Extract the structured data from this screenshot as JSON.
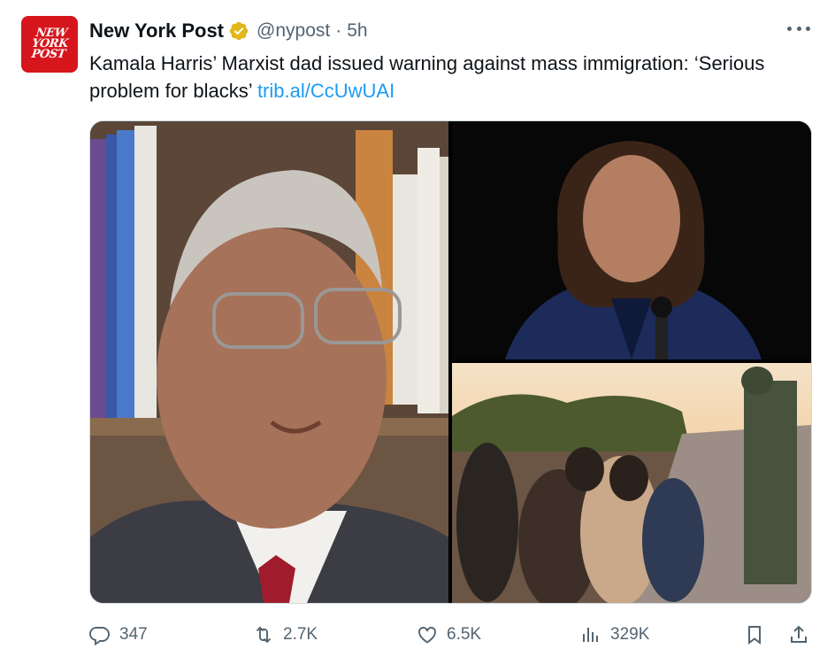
{
  "tweet": {
    "author": {
      "avatar_lines": [
        "NEW",
        "YORK",
        "POST"
      ],
      "name": "New York Post",
      "verified_badge": "gold-verified-badge-icon",
      "handle": "@nypost",
      "separator": "·",
      "timestamp": "5h"
    },
    "menu_icon": "more-horizontal-icon",
    "text": {
      "body": "Kamala Harris’ Marxist dad issued warning against mass immigration: ‘Serious problem for blacks’",
      "link": "trib.al/CcUwUAI"
    },
    "media": [
      {
        "icon": "photo-portrait-elderly-man"
      },
      {
        "icon": "photo-kamala-harris-podium"
      },
      {
        "icon": "photo-migrants-border"
      }
    ],
    "actions": {
      "reply": {
        "icon": "reply-icon",
        "count": "347"
      },
      "retweet": {
        "icon": "retweet-icon",
        "count": "2.7K"
      },
      "like": {
        "icon": "heart-icon",
        "count": "6.5K"
      },
      "views": {
        "icon": "views-chart-icon",
        "count": "329K"
      },
      "bookmark": {
        "icon": "bookmark-icon"
      },
      "share": {
        "icon": "share-icon"
      }
    },
    "colors": {
      "link": "#1d9bf0",
      "secondary_text": "#536471",
      "brand_red": "#d6151d",
      "verified_gold": "#e2b719"
    }
  }
}
